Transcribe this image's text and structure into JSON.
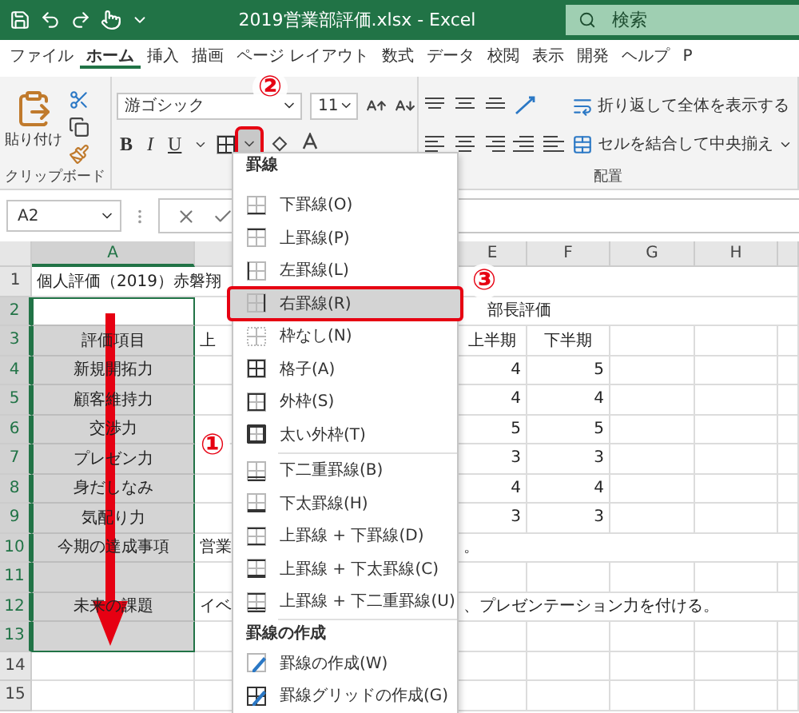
{
  "title_bar": {
    "title": "2019営業部評価.xlsx  -  Excel",
    "search": {
      "placeholder": "検索"
    }
  },
  "ribbon_tabs": [
    {
      "label": "ファイル",
      "selected": false
    },
    {
      "label": "ホーム",
      "selected": true
    },
    {
      "label": "挿入",
      "selected": false
    },
    {
      "label": "描画",
      "selected": false
    },
    {
      "label": "ページ レイアウト",
      "selected": false
    },
    {
      "label": "数式",
      "selected": false
    },
    {
      "label": "データ",
      "selected": false
    },
    {
      "label": "校閲",
      "selected": false
    },
    {
      "label": "表示",
      "selected": false
    },
    {
      "label": "開発",
      "selected": false
    },
    {
      "label": "ヘルプ",
      "selected": false
    },
    {
      "label": "P",
      "selected": false
    }
  ],
  "ribbon": {
    "clipboard": {
      "paste": "貼り付け",
      "label": "クリップボード"
    },
    "font": {
      "name": "游ゴシック",
      "size": "11",
      "bold": "B",
      "italic": "I",
      "underline": "U",
      "border_button": {
        "open": true
      }
    },
    "alignment": {
      "wrap": "折り返して全体を表示する",
      "merge": "セルを結合して中央揃え",
      "label": "配置"
    }
  },
  "formula_bar": {
    "name_box": "A2"
  },
  "sheet": {
    "column_headers": {
      "a": {
        "label": "A",
        "selected": true
      },
      "e": {
        "label": "E",
        "selected": false
      },
      "f": {
        "label": "F",
        "selected": false
      },
      "g": {
        "label": "G",
        "selected": false
      },
      "h": {
        "label": "H",
        "selected": false
      }
    },
    "rows": [
      {
        "header": "1",
        "selected": false,
        "cells": {
          "a": {
            "text": "個人評価（2019）赤磐翔",
            "kind": "text"
          }
        }
      },
      {
        "header": "2",
        "selected": true,
        "active": true,
        "cells": {
          "e": {
            "text": "部長評価",
            "kind": "offset"
          }
        }
      },
      {
        "header": "3",
        "selected": true,
        "cells": {
          "a": {
            "text": "評価項目",
            "kind": "center"
          },
          "b": {
            "text": "上",
            "kind": "text"
          },
          "e": {
            "text": "上半期",
            "kind": "center"
          },
          "f": {
            "text": "下半期",
            "kind": "center"
          }
        }
      },
      {
        "header": "4",
        "selected": true,
        "cells": {
          "a": {
            "text": "新規開拓力",
            "kind": "center"
          },
          "e": {
            "text": "4",
            "kind": "number"
          },
          "f": {
            "text": "5",
            "kind": "number"
          }
        }
      },
      {
        "header": "5",
        "selected": true,
        "cells": {
          "a": {
            "text": "顧客維持力",
            "kind": "center"
          },
          "e": {
            "text": "4",
            "kind": "number"
          },
          "f": {
            "text": "4",
            "kind": "number"
          }
        }
      },
      {
        "header": "6",
        "selected": true,
        "cells": {
          "a": {
            "text": "交渉力",
            "kind": "center"
          },
          "e": {
            "text": "5",
            "kind": "number"
          },
          "f": {
            "text": "5",
            "kind": "number"
          }
        }
      },
      {
        "header": "7",
        "selected": true,
        "cells": {
          "a": {
            "text": "プレゼン力",
            "kind": "center"
          },
          "e": {
            "text": "3",
            "kind": "number"
          },
          "f": {
            "text": "3",
            "kind": "number"
          }
        }
      },
      {
        "header": "8",
        "selected": true,
        "cells": {
          "a": {
            "text": "身だしなみ",
            "kind": "center"
          },
          "e": {
            "text": "4",
            "kind": "number"
          },
          "f": {
            "text": "4",
            "kind": "number"
          }
        }
      },
      {
        "header": "9",
        "selected": true,
        "cells": {
          "a": {
            "text": "気配り力",
            "kind": "center"
          },
          "e": {
            "text": "3",
            "kind": "number"
          },
          "f": {
            "text": "3",
            "kind": "number"
          }
        }
      },
      {
        "header": "10",
        "selected": true,
        "cells": {
          "a": {
            "text": "今期の達成事項",
            "kind": "center"
          },
          "b": {
            "text": "営業",
            "kind": "text"
          },
          "e": {
            "text": "。",
            "kind": "text"
          }
        }
      },
      {
        "header": "11",
        "selected": true,
        "cells": {}
      },
      {
        "header": "12",
        "selected": true,
        "cells": {
          "a": {
            "text": "未来の課題",
            "kind": "center"
          },
          "b": {
            "text": "イベ",
            "kind": "text"
          },
          "e": {
            "text": "、プレゼンテーション力を付ける。",
            "kind": "text"
          }
        }
      },
      {
        "header": "13",
        "selected": true,
        "cells": {}
      },
      {
        "header": "14",
        "selected": false,
        "cells": {}
      },
      {
        "header": "15",
        "selected": false,
        "cells": {}
      }
    ]
  },
  "border_menu": {
    "items": [
      {
        "kind": "heading",
        "label": "罫線"
      },
      {
        "kind": "bottom",
        "label": "下罫線(O)",
        "selected": false
      },
      {
        "kind": "top",
        "label": "上罫線(P)",
        "selected": false
      },
      {
        "kind": "left",
        "label": "左罫線(L)",
        "selected": false
      },
      {
        "kind": "right",
        "label": "右罫線(R)",
        "selected": true
      },
      {
        "kind": "none",
        "label": "枠なし(N)",
        "selected": false
      },
      {
        "kind": "all",
        "label": "格子(A)",
        "selected": false
      },
      {
        "kind": "outside",
        "label": "外枠(S)",
        "selected": false
      },
      {
        "kind": "thickbox",
        "label": "太い外枠(T)",
        "selected": false
      },
      {
        "kind": "divider"
      },
      {
        "kind": "doublebottom",
        "label": "下二重罫線(B)",
        "selected": false
      },
      {
        "kind": "thickbottom",
        "label": "下太罫線(H)",
        "selected": false
      },
      {
        "kind": "topbottom",
        "label": "上罫線 + 下罫線(D)",
        "selected": false
      },
      {
        "kind": "topthickbottom",
        "label": "上罫線 + 下太罫線(C)",
        "selected": false
      },
      {
        "kind": "topdoublebottom",
        "label": "上罫線 + 下二重罫線(U)",
        "selected": false
      },
      {
        "kind": "divider"
      },
      {
        "kind": "heading",
        "label": "罫線の作成"
      },
      {
        "kind": "draw",
        "label": "罫線の作成(W)",
        "selected": false
      },
      {
        "kind": "drawgrid",
        "label": "罫線グリッドの作成(G)",
        "selected": false
      }
    ]
  },
  "annotations": [
    {
      "kind": "circled",
      "text": "②"
    },
    {
      "kind": "circled",
      "text": "③"
    },
    {
      "kind": "arrow"
    },
    {
      "kind": "circled",
      "text": "①"
    }
  ]
}
